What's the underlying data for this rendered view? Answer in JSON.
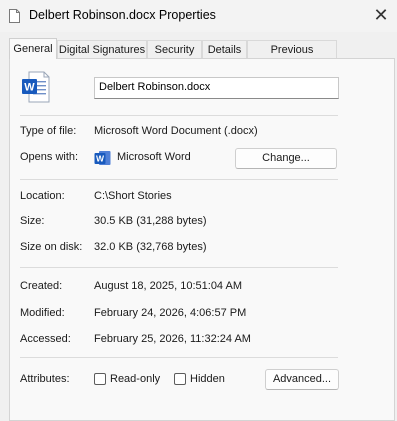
{
  "window": {
    "title": "Delbert Robinson.docx Properties",
    "close_glyph": "✕"
  },
  "tabs": [
    {
      "label": "General",
      "active": true
    },
    {
      "label": "Digital Signatures",
      "active": false
    },
    {
      "label": "Security",
      "active": false
    },
    {
      "label": "Details",
      "active": false
    },
    {
      "label": "Previous Versions",
      "active": false
    }
  ],
  "general": {
    "file_name": "Delbert Robinson.docx",
    "file_icon": "word-document-icon",
    "type_label": "Type of file:",
    "type_value": "Microsoft Word Document (.docx)",
    "opens_label": "Opens with:",
    "opens_app": "Microsoft Word",
    "opens_app_icon": "word-app-icon",
    "change_button": "Change...",
    "location_label": "Location:",
    "location_value": "C:\\Short Stories",
    "size_label": "Size:",
    "size_value": "30.5 KB (31,288 bytes)",
    "size_on_disk_label": "Size on disk:",
    "size_on_disk_value": "32.0 KB (32,768 bytes)",
    "created_label": "Created:",
    "created_value": "August 18, 2025, 10:51:04 AM",
    "modified_label": "Modified:",
    "modified_value": "February 24, 2026, 4:06:57 PM",
    "accessed_label": "Accessed:",
    "accessed_value": "February 25, 2026, 11:32:24 AM",
    "attributes_label": "Attributes:",
    "readonly_label": "Read-only",
    "readonly_checked": false,
    "hidden_label": "Hidden",
    "hidden_checked": false,
    "advanced_button": "Advanced..."
  },
  "colors": {
    "word_blue": "#185abd",
    "window_bg": "#f0f0f0",
    "panel_bg": "#f9f9f9"
  }
}
